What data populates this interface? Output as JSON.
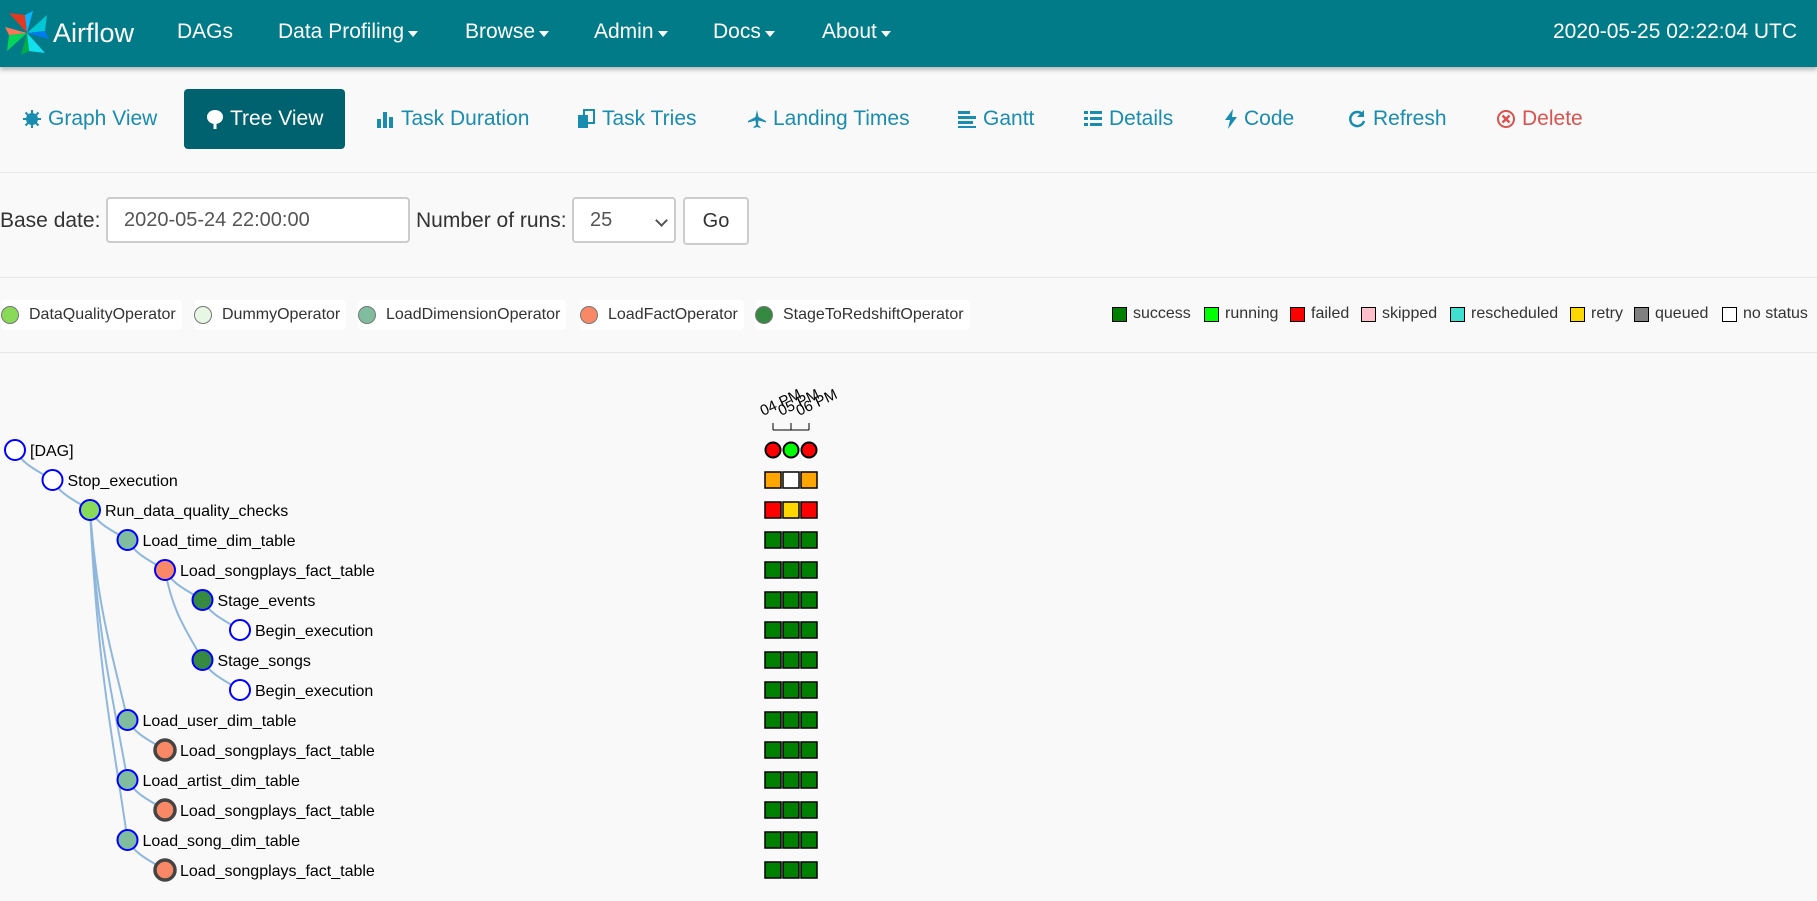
{
  "navbar": {
    "brand": "Airflow",
    "items": [
      {
        "label": "DAGs",
        "dropdown": false
      },
      {
        "label": "Data Profiling",
        "dropdown": true
      },
      {
        "label": "Browse",
        "dropdown": true
      },
      {
        "label": "Admin",
        "dropdown": true
      },
      {
        "label": "Docs",
        "dropdown": true
      },
      {
        "label": "About",
        "dropdown": true
      }
    ],
    "clock": "2020-05-25 02:22:04 UTC",
    "background": "#017b87"
  },
  "tabs": [
    {
      "label": "Graph View",
      "icon": "graph-icon",
      "active": false
    },
    {
      "label": "Tree View",
      "icon": "tree-icon",
      "active": true
    },
    {
      "label": "Task Duration",
      "icon": "bar-chart-icon",
      "active": false
    },
    {
      "label": "Task Tries",
      "icon": "duplicate-icon",
      "active": false
    },
    {
      "label": "Landing Times",
      "icon": "plane-icon",
      "active": false
    },
    {
      "label": "Gantt",
      "icon": "gantt-icon",
      "active": false
    },
    {
      "label": "Details",
      "icon": "list-icon",
      "active": false
    },
    {
      "label": "Code",
      "icon": "flash-icon",
      "active": false
    },
    {
      "label": "Refresh",
      "icon": "refresh-icon",
      "active": false
    },
    {
      "label": "Delete",
      "icon": "remove-icon",
      "active": false,
      "color": "#d9534f"
    }
  ],
  "form": {
    "base_date_label": "Base date:",
    "base_date_value": "2020-05-24 22:00:00",
    "num_runs_label": "Number of runs:",
    "num_runs_value": "25",
    "go_label": "Go"
  },
  "operators": [
    {
      "label": "DataQualityOperator",
      "color": "#89da59"
    },
    {
      "label": "DummyOperator",
      "color": "#e8f7e4"
    },
    {
      "label": "LoadDimensionOperator",
      "color": "#80bd9e"
    },
    {
      "label": "LoadFactOperator",
      "color": "#f98866"
    },
    {
      "label": "StageToRedshiftOperator",
      "color": "#358940"
    }
  ],
  "states": [
    {
      "label": "success",
      "color": "#008000"
    },
    {
      "label": "running",
      "color": "#00ff00"
    },
    {
      "label": "failed",
      "color": "#ff0000"
    },
    {
      "label": "skipped",
      "color": "#ffc0cb"
    },
    {
      "label": "rescheduled",
      "color": "#40e0d0"
    },
    {
      "label": "retry",
      "color": "#ffd700"
    },
    {
      "label": "queued",
      "color": "#808080"
    },
    {
      "label": "no status",
      "color": "#ffffff"
    }
  ],
  "tree": {
    "run_headers": [
      "04 PM",
      "05 PM",
      "06 PM"
    ],
    "dag_runs": [
      "failed",
      "running",
      "failed"
    ],
    "nodes": [
      {
        "label": "[DAG]",
        "depth": 0,
        "parent": -1,
        "fill": "#ffffff",
        "stroke": "#0000ff",
        "status": [
          "failed",
          "running",
          "failed"
        ]
      },
      {
        "label": "Stop_execution",
        "depth": 1,
        "parent": 0,
        "fill": "#ffffff",
        "stroke": "#0000ff",
        "status": [
          "upstream_failed",
          "no_status",
          "upstream_failed"
        ]
      },
      {
        "label": "Run_data_quality_checks",
        "depth": 2,
        "parent": 1,
        "fill": "#89da59",
        "stroke": "#0000ff",
        "status": [
          "failed",
          "retry",
          "failed"
        ]
      },
      {
        "label": "Load_time_dim_table",
        "depth": 3,
        "parent": 2,
        "fill": "#80bd9e",
        "stroke": "#0000ff",
        "status": [
          "success",
          "success",
          "success"
        ]
      },
      {
        "label": "Load_songplays_fact_table",
        "depth": 4,
        "parent": 3,
        "fill": "#f98866",
        "stroke": "#0000ff",
        "status": [
          "success",
          "success",
          "success"
        ]
      },
      {
        "label": "Stage_events",
        "depth": 5,
        "parent": 4,
        "fill": "#358940",
        "stroke": "#0000ff",
        "status": [
          "success",
          "success",
          "success"
        ]
      },
      {
        "label": "Begin_execution",
        "depth": 6,
        "parent": 5,
        "fill": "#ffffff",
        "stroke": "#0000ff",
        "status": [
          "success",
          "success",
          "success"
        ]
      },
      {
        "label": "Stage_songs",
        "depth": 5,
        "parent": 4,
        "fill": "#358940",
        "stroke": "#0000ff",
        "status": [
          "success",
          "success",
          "success"
        ]
      },
      {
        "label": "Begin_execution",
        "depth": 6,
        "parent": 7,
        "fill": "#ffffff",
        "stroke": "#0000ff",
        "status": [
          "success",
          "success",
          "success"
        ]
      },
      {
        "label": "Load_user_dim_table",
        "depth": 3,
        "parent": 2,
        "fill": "#80bd9e",
        "stroke": "#0000ff",
        "status": [
          "success",
          "success",
          "success"
        ]
      },
      {
        "label": "Load_songplays_fact_table",
        "depth": 4,
        "parent": 9,
        "fill": "#f98866",
        "stroke": "#444444",
        "status": [
          "success",
          "success",
          "success"
        ]
      },
      {
        "label": "Load_artist_dim_table",
        "depth": 3,
        "parent": 2,
        "fill": "#80bd9e",
        "stroke": "#0000ff",
        "status": [
          "success",
          "success",
          "success"
        ]
      },
      {
        "label": "Load_songplays_fact_table",
        "depth": 4,
        "parent": 11,
        "fill": "#f98866",
        "stroke": "#444444",
        "status": [
          "success",
          "success",
          "success"
        ]
      },
      {
        "label": "Load_song_dim_table",
        "depth": 3,
        "parent": 2,
        "fill": "#80bd9e",
        "stroke": "#0000ff",
        "status": [
          "success",
          "success",
          "success"
        ]
      },
      {
        "label": "Load_songplays_fact_table",
        "depth": 4,
        "parent": 13,
        "fill": "#f98866",
        "stroke": "#444444",
        "status": [
          "success",
          "success",
          "success"
        ]
      }
    ],
    "status_colors": {
      "success": "#008000",
      "running": "#00ff00",
      "failed": "#ff0000",
      "upstream_failed": "#ffa500",
      "retry": "#ffd700",
      "no_status": "#ffffff"
    }
  }
}
